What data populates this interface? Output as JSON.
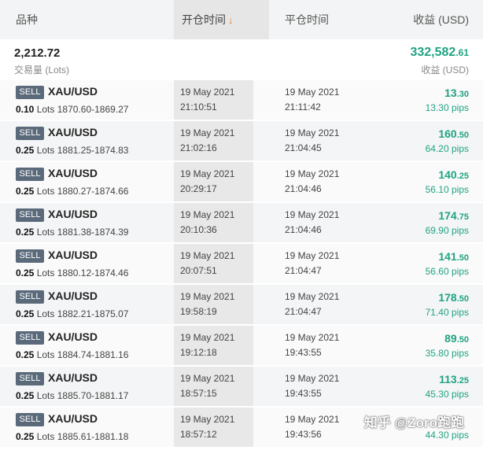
{
  "header": {
    "instrument": "品种",
    "open_time": "开仓时间",
    "sort_icon": "↓",
    "close_time": "平仓时间",
    "pnl": "收益 (USD)"
  },
  "summary": {
    "volume": "2,212.72",
    "volume_label": "交易量 (Lots)",
    "pnl_main": "332,582",
    "pnl_cents": ".61",
    "pnl_label": "收益 (USD)"
  },
  "trades": [
    {
      "side": "SELL",
      "symbol": "XAU/USD",
      "lots": "0.10",
      "lots_unit": "Lots",
      "prices": "1870.60-1869.27",
      "open_date": "19 May 2021",
      "open_time": "21:10:51",
      "close_date": "19 May 2021",
      "close_time": "21:11:42",
      "pnl_main": "13",
      "pnl_cents": ".30",
      "pips": "13.30 pips"
    },
    {
      "side": "SELL",
      "symbol": "XAU/USD",
      "lots": "0.25",
      "lots_unit": "Lots",
      "prices": "1881.25-1874.83",
      "open_date": "19 May 2021",
      "open_time": "21:02:16",
      "close_date": "19 May 2021",
      "close_time": "21:04:45",
      "pnl_main": "160",
      "pnl_cents": ".50",
      "pips": "64.20 pips"
    },
    {
      "side": "SELL",
      "symbol": "XAU/USD",
      "lots": "0.25",
      "lots_unit": "Lots",
      "prices": "1880.27-1874.66",
      "open_date": "19 May 2021",
      "open_time": "20:29:17",
      "close_date": "19 May 2021",
      "close_time": "21:04:46",
      "pnl_main": "140",
      "pnl_cents": ".25",
      "pips": "56.10 pips"
    },
    {
      "side": "SELL",
      "symbol": "XAU/USD",
      "lots": "0.25",
      "lots_unit": "Lots",
      "prices": "1881.38-1874.39",
      "open_date": "19 May 2021",
      "open_time": "20:10:36",
      "close_date": "19 May 2021",
      "close_time": "21:04:46",
      "pnl_main": "174",
      "pnl_cents": ".75",
      "pips": "69.90 pips"
    },
    {
      "side": "SELL",
      "symbol": "XAU/USD",
      "lots": "0.25",
      "lots_unit": "Lots",
      "prices": "1880.12-1874.46",
      "open_date": "19 May 2021",
      "open_time": "20:07:51",
      "close_date": "19 May 2021",
      "close_time": "21:04:47",
      "pnl_main": "141",
      "pnl_cents": ".50",
      "pips": "56.60 pips"
    },
    {
      "side": "SELL",
      "symbol": "XAU/USD",
      "lots": "0.25",
      "lots_unit": "Lots",
      "prices": "1882.21-1875.07",
      "open_date": "19 May 2021",
      "open_time": "19:58:19",
      "close_date": "19 May 2021",
      "close_time": "21:04:47",
      "pnl_main": "178",
      "pnl_cents": ".50",
      "pips": "71.40 pips"
    },
    {
      "side": "SELL",
      "symbol": "XAU/USD",
      "lots": "0.25",
      "lots_unit": "Lots",
      "prices": "1884.74-1881.16",
      "open_date": "19 May 2021",
      "open_time": "19:12:18",
      "close_date": "19 May 2021",
      "close_time": "19:43:55",
      "pnl_main": "89",
      "pnl_cents": ".50",
      "pips": "35.80 pips"
    },
    {
      "side": "SELL",
      "symbol": "XAU/USD",
      "lots": "0.25",
      "lots_unit": "Lots",
      "prices": "1885.70-1881.17",
      "open_date": "19 May 2021",
      "open_time": "18:57:15",
      "close_date": "19 May 2021",
      "close_time": "19:43:55",
      "pnl_main": "113",
      "pnl_cents": ".25",
      "pips": "45.30 pips"
    },
    {
      "side": "SELL",
      "symbol": "XAU/USD",
      "lots": "0.25",
      "lots_unit": "Lots",
      "prices": "1885.61-1881.18",
      "open_date": "19 May 2021",
      "open_time": "18:57:12",
      "close_date": "19 May 2021",
      "close_time": "19:43:56",
      "pnl_main": "",
      "pnl_cents": "",
      "pips": "44.30 pips"
    }
  ],
  "watermark": "知乎 @Zoro跑跑",
  "colors": {
    "profit": "#20a383",
    "badge": "#5a6a7b",
    "sort_accent": "#f0842c"
  }
}
